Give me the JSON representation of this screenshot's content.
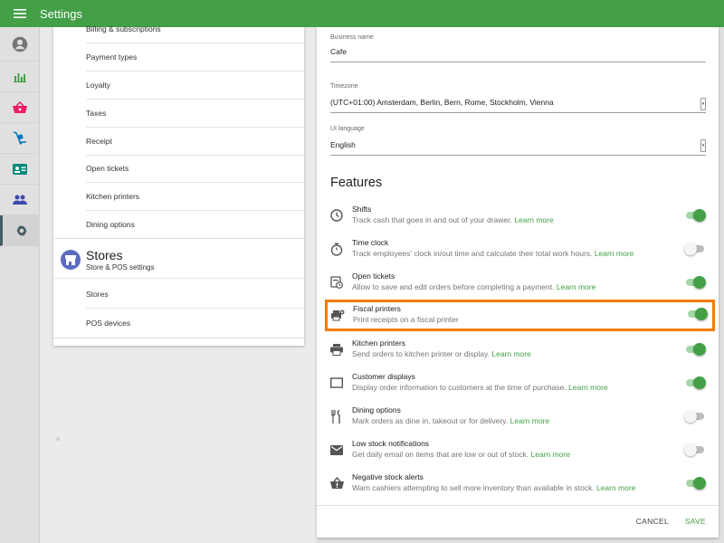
{
  "app": {
    "title": "Settings"
  },
  "left_menu": {
    "items_top": [
      "Billing & subscriptions",
      "Payment types",
      "Loyalty",
      "Taxes",
      "Receipt",
      "Open tickets",
      "Kitchen printers",
      "Dining options"
    ],
    "stores_section": {
      "title": "Stores",
      "subtitle": "Store & POS settings",
      "items": [
        "Stores",
        "POS devices"
      ]
    }
  },
  "form": {
    "business_name": {
      "label": "Business name",
      "value": "Cafe"
    },
    "timezone": {
      "label": "Timezone",
      "value": "(UTC+01:00) Amsterdam, Berlin, Bern, Rome, Stockholm, Vienna"
    },
    "ui_language": {
      "label": "UI language",
      "value": "English"
    }
  },
  "features": {
    "heading": "Features",
    "learn_more": "Learn more",
    "items": [
      {
        "title": "Shifts",
        "desc": "Track cash that goes in and out of your drawer.",
        "link": "Learn more",
        "on": true
      },
      {
        "title": "Time clock",
        "desc": "Track employees' clock in/out time and calculate their total work hours.",
        "link": "Learn more",
        "on": false
      },
      {
        "title": "Open tickets",
        "desc": "Allow to save and edit orders before completing a payment.",
        "link": "Learn more",
        "on": true
      },
      {
        "title": "Fiscal printers",
        "desc": "Print receipts on a fiscal printer",
        "link": "",
        "on": true
      },
      {
        "title": "Kitchen printers",
        "desc": "Send orders to kitchen printer or display.",
        "link": "Learn more",
        "on": true
      },
      {
        "title": "Customer displays",
        "desc": "Display order information to customers at the time of purchase.",
        "link": "Learn more",
        "on": true
      },
      {
        "title": "Dining options",
        "desc": "Mark orders as dine in, takeout or for delivery.",
        "link": "Learn more",
        "on": false
      },
      {
        "title": "Low stock notifications",
        "desc": "Get daily email on items that are low or out of stock.",
        "link": "Learn more",
        "on": false
      },
      {
        "title": "Negative stock alerts",
        "desc": "Warn cashiers attempting to sell more inventory than available in stock.",
        "link": "Learn more",
        "on": true
      }
    ]
  },
  "footer": {
    "cancel": "CANCEL",
    "save": "SAVE"
  },
  "colors": {
    "primary": "#43a047",
    "highlight": "#f57c00",
    "stores_avatar": "#5c6bc0"
  }
}
